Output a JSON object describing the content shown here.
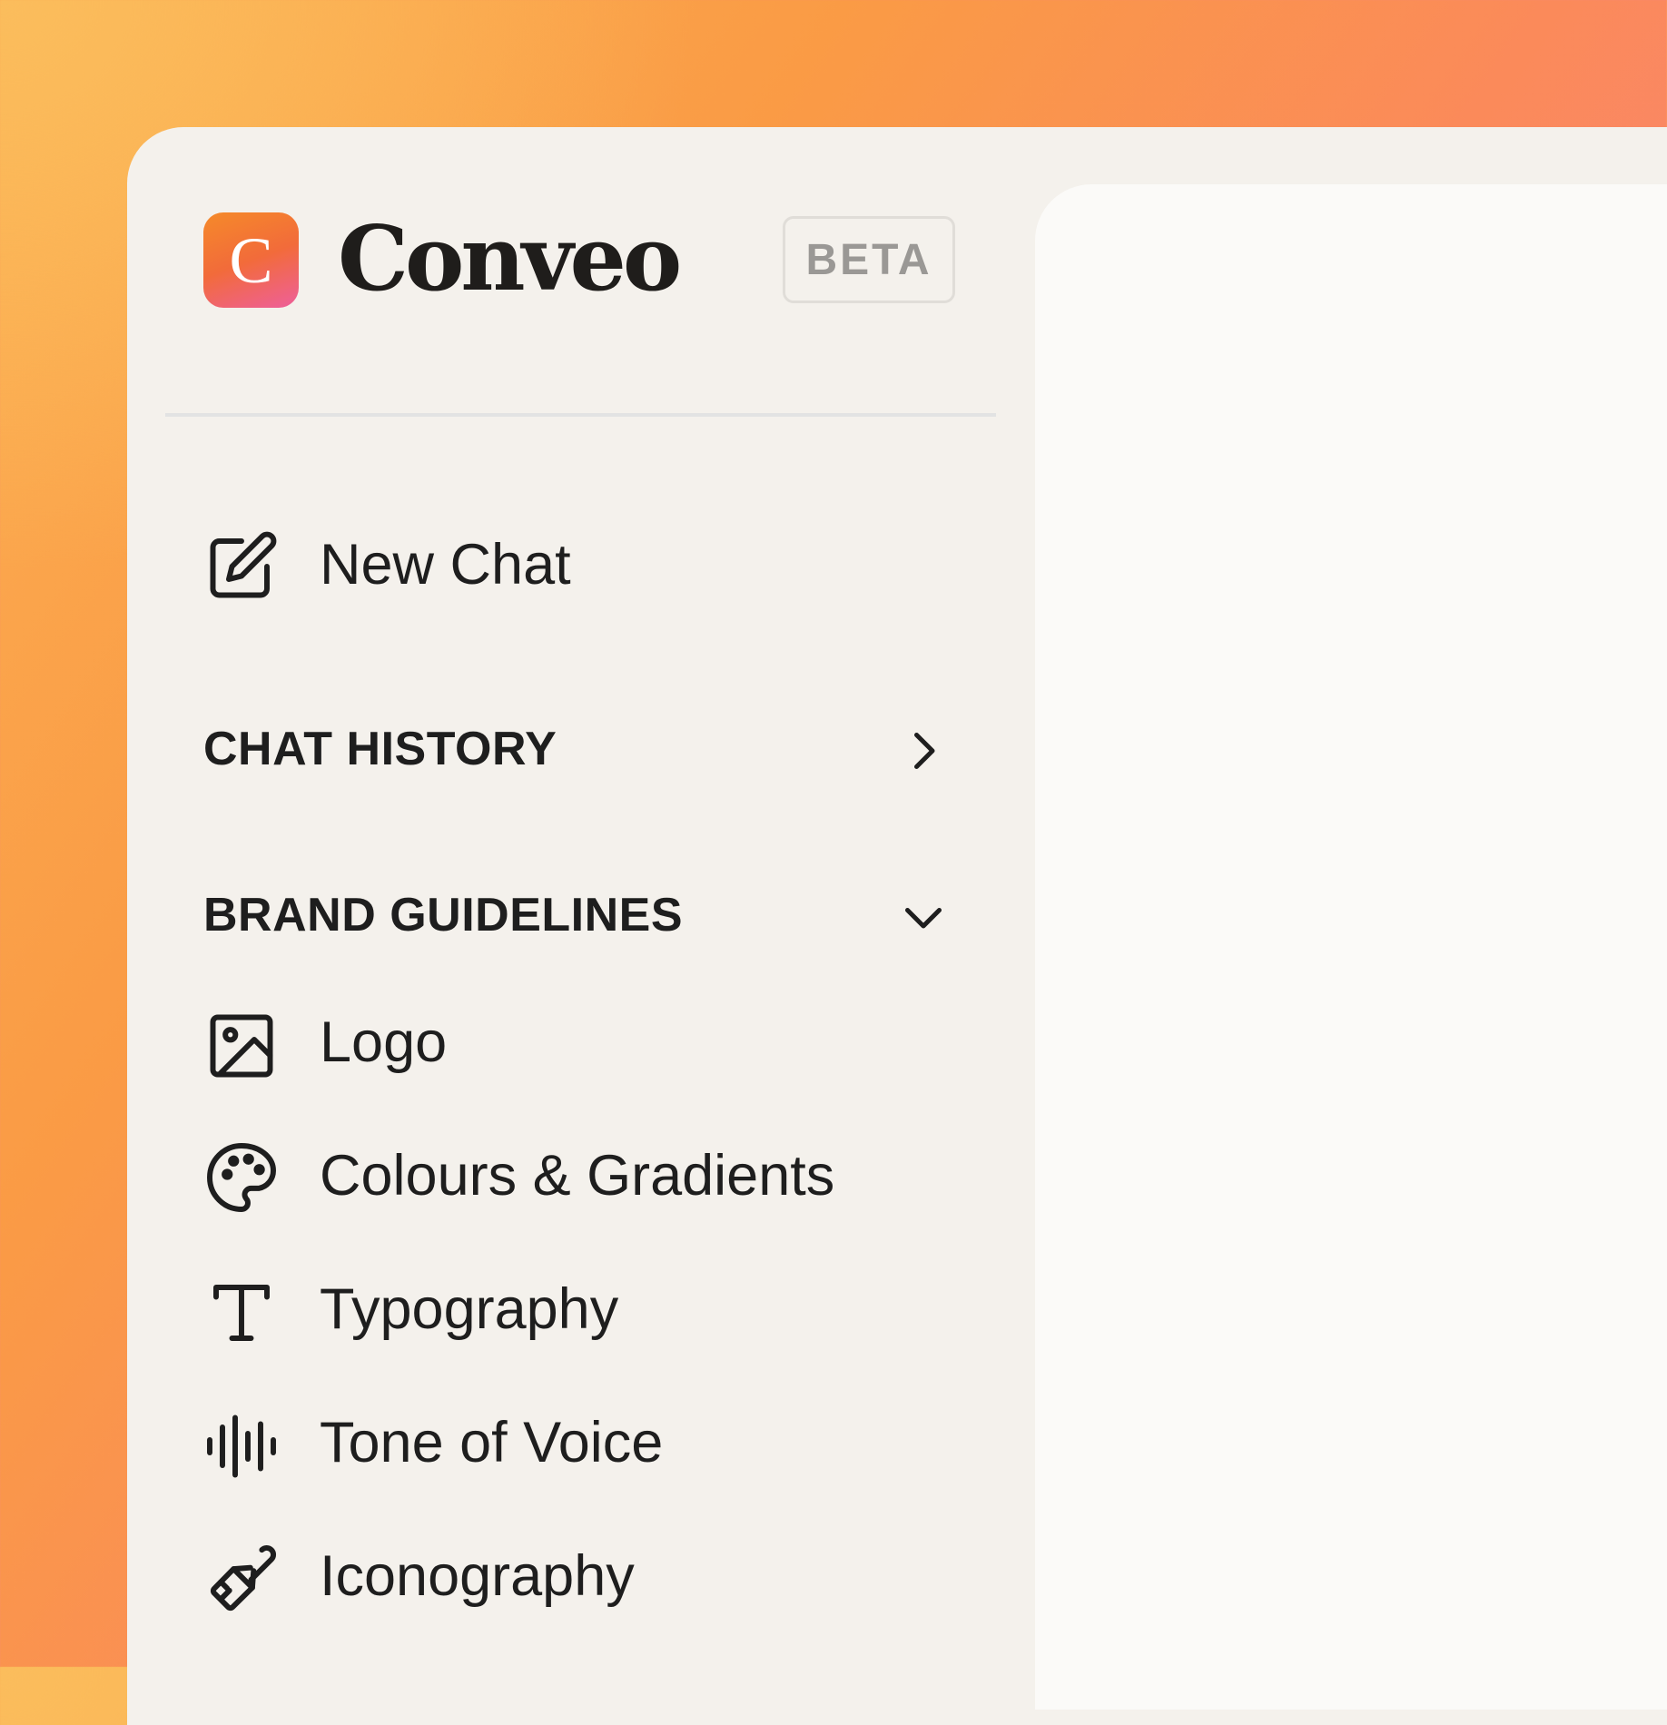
{
  "brand": {
    "logo_letter": "C",
    "name": "Conveo",
    "badge": "BETA"
  },
  "sidebar": {
    "new_chat": {
      "label": "New Chat",
      "icon": "edit-icon"
    },
    "chat_history": {
      "title": "CHAT HISTORY",
      "icon": "chevron-right-icon"
    },
    "brand_guidelines": {
      "title": "BRAND GUIDELINES",
      "icon": "chevron-down-icon",
      "items": [
        {
          "label": "Logo",
          "icon": "image-icon"
        },
        {
          "label": "Colours & Gradients",
          "icon": "palette-icon"
        },
        {
          "label": "Typography",
          "icon": "type-icon"
        },
        {
          "label": "Tone of Voice",
          "icon": "audio-waveform-icon"
        },
        {
          "label": "Iconography",
          "icon": "paintbrush-icon"
        }
      ]
    }
  },
  "colors": {
    "window_bg": "#f4f1ec",
    "content_bg": "#fbfaf8",
    "text": "#1e1e1e",
    "badge_text": "#9a9895",
    "logo_gradient_start": "#f58a2a",
    "logo_gradient_end": "#ee5f9b"
  }
}
